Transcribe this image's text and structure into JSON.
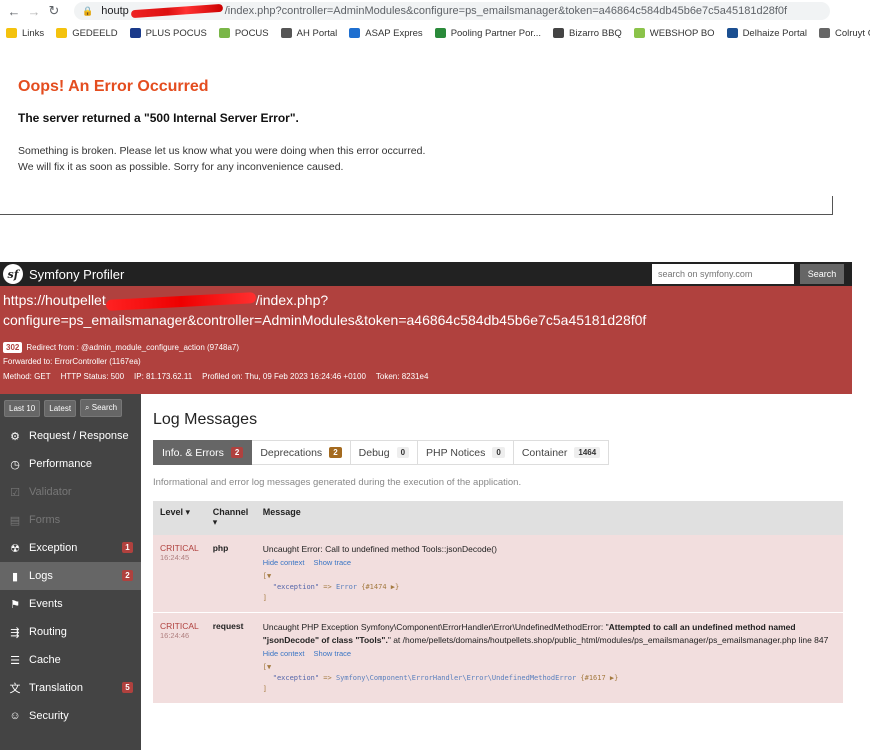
{
  "browser": {
    "url_host": "houtp",
    "url_rest": "/index.php?controller=AdminModules&configure=ps_emailsmanager&token=a46864c584db45b6e7c5a45181d28f0f",
    "bookmarks": [
      {
        "label": "Links",
        "icon": "folder-icon",
        "color": "#f4c20d"
      },
      {
        "label": "GEDEELD",
        "icon": "folder-icon",
        "color": "#f4c20d"
      },
      {
        "label": "PLUS POCUS",
        "icon": "plus-logo-icon",
        "color": "#1a3a8a"
      },
      {
        "label": "POCUS",
        "icon": "pocus-logo-icon",
        "color": "#7ab648"
      },
      {
        "label": "AH Portal",
        "icon": "ah-logo-icon",
        "color": "#555555"
      },
      {
        "label": "ASAP Expres",
        "icon": "asap-logo-icon",
        "color": "#1e6fd0"
      },
      {
        "label": "Pooling Partner Por...",
        "icon": "pooling-logo-icon",
        "color": "#2a8a3a"
      },
      {
        "label": "Bizarro BBQ",
        "icon": "bizarro-logo-icon",
        "color": "#444444"
      },
      {
        "label": "WEBSHOP BO",
        "icon": "webshop-logo-icon",
        "color": "#8bc34a"
      },
      {
        "label": "Delhaize Portal",
        "icon": "delhaize-logo-icon",
        "color": "#1b4f91"
      },
      {
        "label": "Colruyt Group log",
        "icon": "page-icon",
        "color": "#666666"
      }
    ]
  },
  "error_page": {
    "title": "Oops! An Error Occurred",
    "subtitle": "The server returned a \"500 Internal Server Error\".",
    "message": "Something is broken. Please let us know what you were doing when this error occurred. We will fix it as soon as possible. Sorry for any inconvenience caused."
  },
  "profiler": {
    "brand": "Symfony Profiler",
    "search_placeholder": "search on symfony.com",
    "search_button": "Search",
    "url_line1_start": "https://houtpellet",
    "url_line1_end": "/index.php?",
    "url_line2": "configure=ps_emailsmanager&controller=AdminModules&token=a46864c584db45b6e7c5a45181d28f0f",
    "redirect_code": "302",
    "redirect_text": "Redirect from : @admin_module_configure_action (9748a7)",
    "forwarded": "Forwarded to: ErrorController (1167ea)",
    "meta": {
      "method": "Method: GET",
      "status": "HTTP Status: 500",
      "ip": "IP: 81.173.62.11",
      "profiled": "Profiled on: Thu, 09 Feb 2023 16:24:46 +0100",
      "token": "Token: 8231e4"
    },
    "side_top": [
      "Last 10",
      "Latest",
      "Search"
    ],
    "sidebar": [
      {
        "label": "Request / Response",
        "icon": "request-icon",
        "glyph": "⚙",
        "disabled": false,
        "active": false,
        "badge": ""
      },
      {
        "label": "Performance",
        "icon": "performance-icon",
        "glyph": "◷",
        "disabled": false,
        "active": false,
        "badge": ""
      },
      {
        "label": "Validator",
        "icon": "validator-icon",
        "glyph": "☑",
        "disabled": true,
        "active": false,
        "badge": ""
      },
      {
        "label": "Forms",
        "icon": "forms-icon",
        "glyph": "▤",
        "disabled": true,
        "active": false,
        "badge": ""
      },
      {
        "label": "Exception",
        "icon": "exception-icon",
        "glyph": "☢",
        "disabled": false,
        "active": false,
        "badge": "1"
      },
      {
        "label": "Logs",
        "icon": "logs-icon",
        "glyph": "▮",
        "disabled": false,
        "active": true,
        "badge": "2"
      },
      {
        "label": "Events",
        "icon": "events-icon",
        "glyph": "⚑",
        "disabled": false,
        "active": false,
        "badge": ""
      },
      {
        "label": "Routing",
        "icon": "routing-icon",
        "glyph": "⇶",
        "disabled": false,
        "active": false,
        "badge": ""
      },
      {
        "label": "Cache",
        "icon": "cache-icon",
        "glyph": "☰",
        "disabled": false,
        "active": false,
        "badge": ""
      },
      {
        "label": "Translation",
        "icon": "translation-icon",
        "glyph": "文",
        "disabled": false,
        "active": false,
        "badge": "5"
      },
      {
        "label": "Security",
        "icon": "security-icon",
        "glyph": "☺",
        "disabled": false,
        "active": false,
        "badge": ""
      }
    ],
    "main_title": "Log Messages",
    "tabs": [
      {
        "label": "Info. & Errors",
        "count": "2",
        "style": "red",
        "active": true
      },
      {
        "label": "Deprecations",
        "count": "2",
        "style": "orange",
        "active": false
      },
      {
        "label": "Debug",
        "count": "0",
        "style": "",
        "active": false
      },
      {
        "label": "PHP Notices",
        "count": "0",
        "style": "",
        "active": false
      },
      {
        "label": "Container",
        "count": "1464",
        "style": "",
        "active": false
      }
    ],
    "description": "Informational and error log messages generated during the execution of the application.",
    "table_headers": {
      "level": "Level ▾",
      "channel": "Channel ▾",
      "message": "Message"
    },
    "logs": [
      {
        "level": "CRITICAL",
        "time": "16:24:45",
        "channel": "php",
        "message": "Uncaught Error: Call to undefined method Tools::jsonDecode()",
        "hide_context": "Hide context",
        "show_trace": "Show trace",
        "dump_key": "\"exception\"",
        "dump_class": "Error",
        "dump_ref": "{#1474 ▶}"
      },
      {
        "level": "CRITICAL",
        "time": "16:24:46",
        "channel": "request",
        "message_a": "Uncaught PHP Exception Symfony\\Component\\ErrorHandler\\Error\\UndefinedMethodError: \"",
        "message_b": "Attempted to call an undefined method named \"jsonDecode\" of class \"Tools\".",
        "message_c": "\" at /home/pellets/domains/houtpellets.shop/public_html/modules/ps_emailsmanager/ps_emailsmanager.php line 847",
        "hide_context": "Hide context",
        "show_trace": "Show trace",
        "dump_key": "\"exception\"",
        "dump_class": "Symfony\\Component\\ErrorHandler\\Error\\UndefinedMethodError",
        "dump_ref": "{#1617 ▶}"
      }
    ]
  }
}
